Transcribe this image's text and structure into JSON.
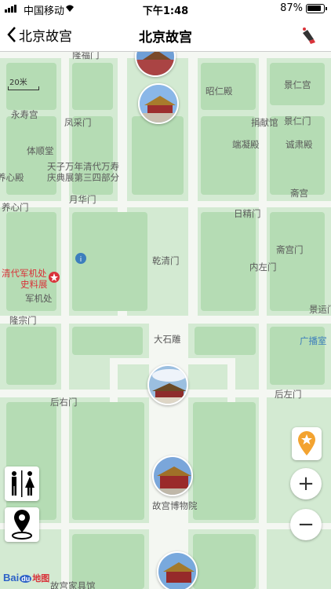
{
  "status_bar": {
    "carrier": "中国移动",
    "time": "下午1:48",
    "battery": "87%"
  },
  "nav": {
    "back_label": "北京故宫",
    "title": "北京故宫",
    "right_icon": "speaker-icon"
  },
  "map": {
    "scale_label": "20米",
    "labels": {
      "longfu_gate": "隆福门",
      "zhaoren_hall": "昭仁殿",
      "jingren_palace": "景仁宫",
      "yongshou_palace": "永寿宫",
      "fengcai_gate": "凤采门",
      "jingxian_gate": "捐献馆",
      "jingren_gate": "景仁门",
      "tishun_hall": "体顺堂",
      "duanning_hall": "端凝殿",
      "chengsu_hall": "诚肃殿",
      "exhibit_line1": "天子万年清代万寿",
      "exhibit_line2": "庆典展第三四部分",
      "yangxin_hall": "养心殿",
      "yuehua_gate": "月华门",
      "zhai_palace": "斋宫",
      "yangxin_gate": "养心门",
      "rijing_gate": "日精门",
      "qianqing_gate": "乾清门",
      "zhaigong_gate": "斋宫门",
      "junjichu_exhibit_line1": "清代军机处",
      "junjichu_exhibit_line2": "史料展",
      "neizuo_gate": "内左门",
      "junjichu": "军机处",
      "longzong_gate": "隆宗门",
      "jingyun_gate": "景运门",
      "dashiyin": "大石雕",
      "broadcast_room": "广播室",
      "houyou_gate": "后右门",
      "houzuo_gate": "后左门",
      "museum": "故宫博物院",
      "furniture_hall": "故宫家具馆"
    }
  },
  "controls": {
    "favorite_icon": "star-pin-icon",
    "zoom_in": "+",
    "zoom_out": "−",
    "restroom_icon": "restroom-icon",
    "location_icon": "location-pin-icon"
  },
  "logo": {
    "prefix": "Bai",
    "du": "du",
    "suffix": "地图"
  },
  "colors": {
    "map_bg": "#d3ead2",
    "block": "#b5dcb4",
    "road": "#f4f7f2",
    "label": "#5a5a5a",
    "accent_blue": "#3d7ebd",
    "accent_red": "#d9333a"
  }
}
